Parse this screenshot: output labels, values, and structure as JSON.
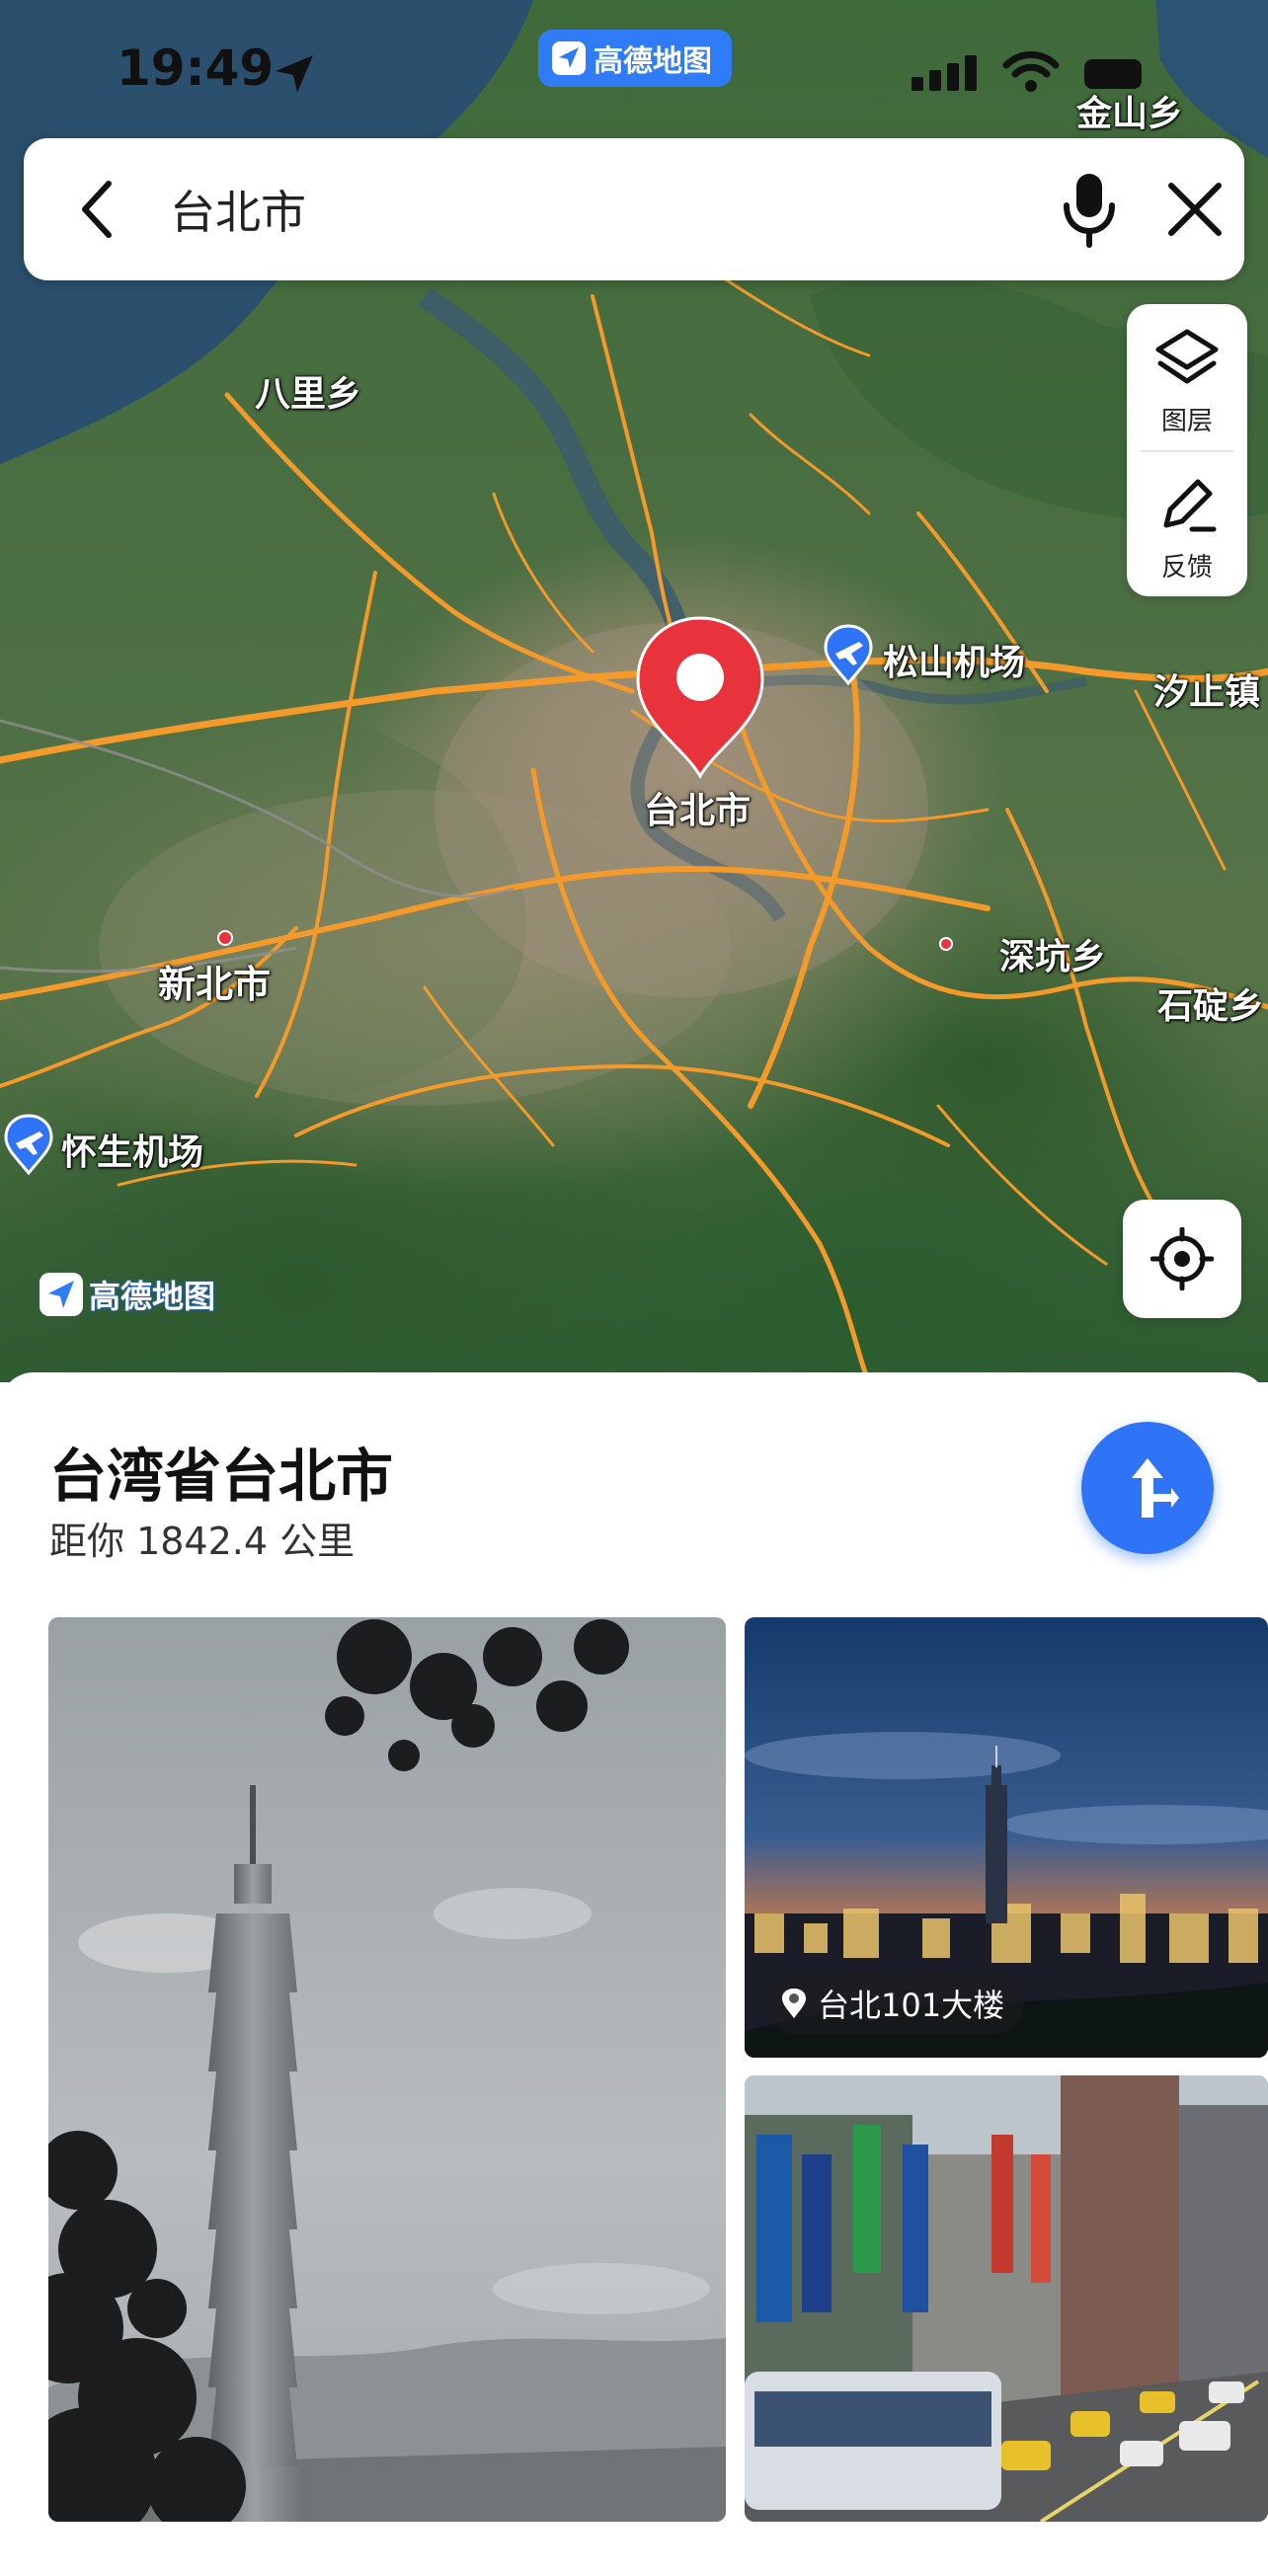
{
  "status_bar": {
    "time": "19:49",
    "brand": "高德地图",
    "location_icon": "location-arrow-icon",
    "signal_icon": "cellular-signal-icon",
    "wifi_icon": "wifi-icon",
    "battery_icon": "battery-icon"
  },
  "search": {
    "query": "台北市",
    "back_icon": "chevron-left-icon",
    "mic_icon": "microphone-icon",
    "close_icon": "close-icon"
  },
  "map": {
    "labels": {
      "jinshan": "金山乡",
      "bali": "八里乡",
      "songshan_airport": "松山机场",
      "xizhi": "汐止镇",
      "taipei": "台北市",
      "shenkeng": "深坑乡",
      "xinbei": "新北市",
      "shiding": "石碇乡",
      "huaisheng_airport": "怀生机场"
    },
    "tools": {
      "layers_label": "图层",
      "feedback_label": "反馈"
    },
    "watermark": "高德地图",
    "colors": {
      "road": "#f39a2a",
      "water": "#2c5470",
      "pin": "#e8323c",
      "accent": "#2f74f6"
    }
  },
  "place": {
    "title": "台湾省台北市",
    "distance": "距你 1842.4 公里",
    "photo_tag": "台北101大楼",
    "nav_icon": "navigate-arrow-icon"
  }
}
